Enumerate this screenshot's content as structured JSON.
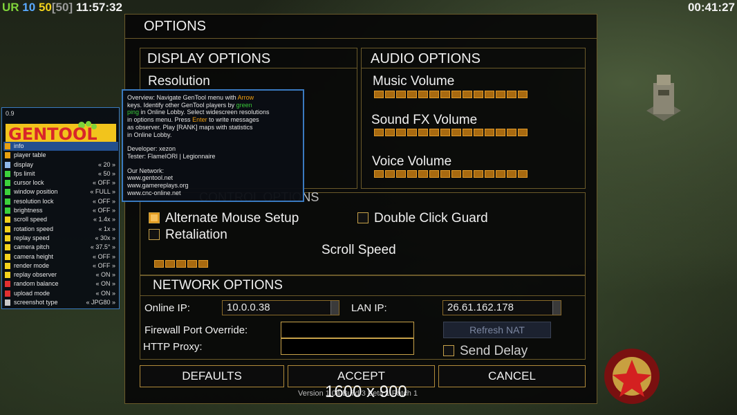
{
  "hud": {
    "rank": "UR",
    "num_a": "10",
    "num_b": "50",
    "num_c": "[50]",
    "clock": "11:57:32",
    "timer": "00:41:27"
  },
  "dialog": {
    "title": "OPTIONS",
    "display": {
      "title": "DISPLAY OPTIONS",
      "resolution_label": "Resolution"
    },
    "audio": {
      "title": "AUDIO OPTIONS",
      "music_label": "Music Volume",
      "sfx_label": "Sound FX Volume",
      "voice_label": "Voice Volume",
      "music_segments": 14,
      "sfx_segments": 14,
      "voice_segments": 14
    },
    "control": {
      "title": "CONTROL OPTIONS",
      "alt_mouse_label": "Alternate Mouse Setup",
      "alt_mouse_checked": true,
      "double_click_label": "Double Click Guard",
      "double_click_checked": false,
      "retaliation_label": "Retaliation",
      "retaliation_checked": false,
      "scroll_speed_label": "Scroll Speed",
      "scroll_segments": 5
    },
    "network": {
      "title": "NETWORK OPTIONS",
      "online_ip_label": "Online IP:",
      "online_ip_value": "10.0.0.38",
      "lan_ip_label": "LAN IP:",
      "lan_ip_value": "26.61.162.178",
      "firewall_label": "Firewall Port Override:",
      "http_proxy_label": "HTTP Proxy:",
      "refresh_nat_label": "Refresh NAT",
      "send_delay_label": "Send Delay",
      "send_delay_checked": false
    },
    "buttons": {
      "defaults": "DEFAULTS",
      "accept": "ACCEPT",
      "cancel": "CANCEL"
    },
    "version": "Version 1.04 Build 3 Beta 1 Patch 1",
    "resolution_overlay": "1600 x 900"
  },
  "gentool": {
    "version": "0.9",
    "logo_text": "GENTOOL",
    "items": [
      {
        "label": "info",
        "value": "",
        "color": "#e8a010",
        "selected": true
      },
      {
        "label": "player table",
        "value": "",
        "color": "#e8a010",
        "selected": false
      },
      {
        "label": "display",
        "value": "« 20 »",
        "color": "#8fb8e8",
        "selected": false
      },
      {
        "label": "fps limit",
        "value": "« 50 »",
        "color": "#3cd23c",
        "selected": false
      },
      {
        "label": "cursor lock",
        "value": "« OFF »",
        "color": "#3cd23c",
        "selected": false
      },
      {
        "label": "window position",
        "value": "« FULL »",
        "color": "#3cd23c",
        "selected": false
      },
      {
        "label": "resolution lock",
        "value": "« OFF »",
        "color": "#3cd23c",
        "selected": false
      },
      {
        "label": "brightness",
        "value": "« OFF »",
        "color": "#3cd23c",
        "selected": false
      },
      {
        "label": "scroll speed",
        "value": "« 1.4x »",
        "color": "#f2d21c",
        "selected": false
      },
      {
        "label": "rotation speed",
        "value": "« 1x »",
        "color": "#f2d21c",
        "selected": false
      },
      {
        "label": "replay speed",
        "value": "« 30x »",
        "color": "#f2d21c",
        "selected": false
      },
      {
        "label": "camera pitch",
        "value": "« 37.5° »",
        "color": "#f2d21c",
        "selected": false
      },
      {
        "label": "camera height",
        "value": "« OFF »",
        "color": "#f2d21c",
        "selected": false
      },
      {
        "label": "render mode",
        "value": "« OFF »",
        "color": "#f2d21c",
        "selected": false
      },
      {
        "label": "replay observer",
        "value": "« ON »",
        "color": "#f2d21c",
        "selected": false
      },
      {
        "label": "random balance",
        "value": "« ON »",
        "color": "#e03030",
        "selected": false
      },
      {
        "label": "upload mode",
        "value": "« ON »",
        "color": "#e03030",
        "selected": false
      },
      {
        "label": "screenshot type",
        "value": "« JPG80 »",
        "color": "#c8c8c8",
        "selected": false
      }
    ]
  },
  "tooltip": {
    "overview_lead": "Overview: Navigate GenTool menu with ",
    "overview_arrow": "Arrow",
    "overview_keys": "keys. Identify other GenTool players by ",
    "overview_green": "green",
    "overview_ping": "ping",
    "overview_lobby": " in Online Lobby. Select widescreen resolutions",
    "overview_menu": "in options menu. Press ",
    "overview_enter": "Enter",
    "overview_write": " to write messages",
    "overview_observer": "as observer. Play [RANK] maps with statistics",
    "overview_stats": "in Online Lobby.",
    "developer": "Developer: xezon",
    "tester": "Tester: FlameIORI | Legionnaire",
    "network_title": "Our Network:",
    "site1": "www.gentool.net",
    "site2": "www.gamereplays.org",
    "site3": "www.cnc-online.net"
  },
  "colors": {
    "accent": "#e39a1c",
    "border": "#6b5a2a",
    "gentool_border": "#3a7ac0"
  }
}
